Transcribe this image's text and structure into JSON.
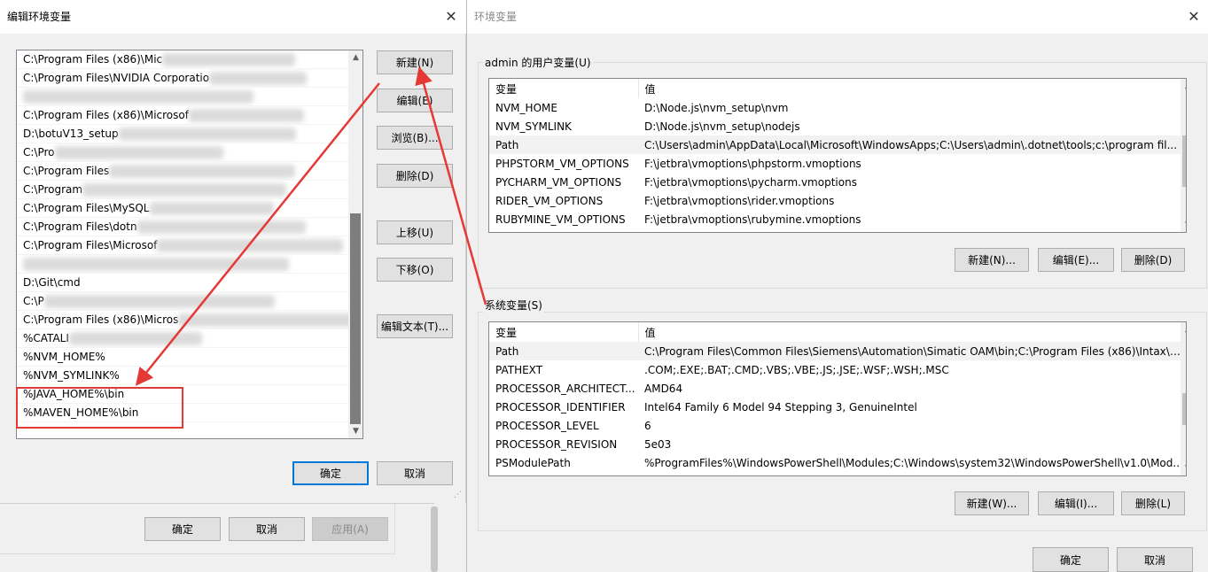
{
  "left_dialog": {
    "title": "编辑环境变量",
    "close_glyph": "✕",
    "path_entries": [
      "C:\\Program Files (x86)\\Mic",
      "C:\\Program Files\\NVIDIA Corporatio",
      "",
      "C:\\Program Files (x86)\\Microsof",
      "D:\\botuV13_setup",
      "C:\\Pro",
      "C:\\Program Files",
      "C:\\Program",
      "C:\\Program Files\\MySQL",
      "C:\\Program Files\\dotn",
      "C:\\Program Files\\Microsof",
      "",
      "D:\\Git\\cmd",
      "C:\\P",
      "C:\\Program Files (x86)\\Micros",
      "%CATALI",
      "%NVM_HOME%",
      "%NVM_SYMLINK%",
      "%JAVA_HOME%\\bin",
      "%MAVEN_HOME%\\bin"
    ],
    "buttons": {
      "new": "新建(N)",
      "edit": "编辑(E)",
      "browse": "浏览(B)...",
      "delete": "删除(D)",
      "move_up": "上移(U)",
      "move_down": "下移(O)",
      "edit_text": "编辑文本(T)...",
      "ok": "确定",
      "cancel": "取消"
    },
    "background_window": {
      "ok": "确定",
      "cancel": "取消",
      "apply": "应用(A)"
    }
  },
  "right_dialog": {
    "title": "环境变量",
    "close_glyph": "✕",
    "user_vars": {
      "label": "admin 的用户变量(U)",
      "columns": [
        "变量",
        "值"
      ],
      "rows": [
        {
          "name": "NVM_HOME",
          "value": "D:\\Node.js\\nvm_setup\\nvm"
        },
        {
          "name": "NVM_SYMLINK",
          "value": "D:\\Node.js\\nvm_setup\\nodejs"
        },
        {
          "name": "Path",
          "value": "C:\\Users\\admin\\AppData\\Local\\Microsoft\\WindowsApps;C:\\Users\\admin\\.dotnet\\tools;c:\\program fil..."
        },
        {
          "name": "PHPSTORM_VM_OPTIONS",
          "value": "F:\\jetbra\\vmoptions\\phpstorm.vmoptions"
        },
        {
          "name": "PYCHARM_VM_OPTIONS",
          "value": "F:\\jetbra\\vmoptions\\pycharm.vmoptions"
        },
        {
          "name": "RIDER_VM_OPTIONS",
          "value": "F:\\jetbra\\vmoptions\\rider.vmoptions"
        },
        {
          "name": "RUBYMINE_VM_OPTIONS",
          "value": "F:\\jetbra\\vmoptions\\rubymine.vmoptions"
        }
      ],
      "selected_index": 2,
      "buttons": {
        "new": "新建(N)...",
        "edit": "编辑(E)...",
        "delete": "删除(D)"
      }
    },
    "system_vars": {
      "label": "系统变量(S)",
      "columns": [
        "变量",
        "值"
      ],
      "rows": [
        {
          "name": "Path",
          "value": "C:\\Program Files\\Common Files\\Siemens\\Automation\\Simatic OAM\\bin;C:\\Program Files (x86)\\Intax\\zf..."
        },
        {
          "name": "PATHEXT",
          "value": ".COM;.EXE;.BAT;.CMD;.VBS;.VBE;.JS;.JSE;.WSF;.WSH;.MSC"
        },
        {
          "name": "PROCESSOR_ARCHITECT...",
          "value": "AMD64"
        },
        {
          "name": "PROCESSOR_IDENTIFIER",
          "value": "Intel64 Family 6 Model 94 Stepping 3, GenuineIntel"
        },
        {
          "name": "PROCESSOR_LEVEL",
          "value": "6"
        },
        {
          "name": "PROCESSOR_REVISION",
          "value": "5e03"
        },
        {
          "name": "PSModulePath",
          "value": "%ProgramFiles%\\WindowsPowerShell\\Modules;C:\\Windows\\system32\\WindowsPowerShell\\v1.0\\Mod..."
        }
      ],
      "selected_index": 0,
      "buttons": {
        "new": "新建(W)...",
        "edit": "编辑(I)...",
        "delete": "删除(L)"
      }
    },
    "buttons": {
      "ok": "确定",
      "cancel": "取消"
    }
  },
  "colors": {
    "annotation": "#e53935",
    "focus": "#0078d7"
  }
}
